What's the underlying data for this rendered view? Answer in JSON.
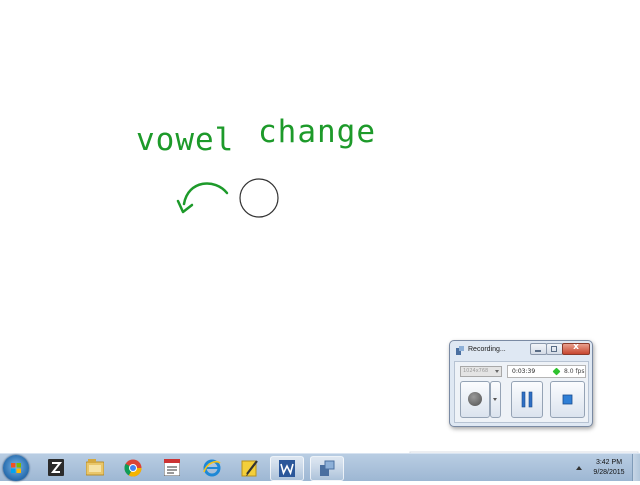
{
  "whiteboard": {
    "text_word1": "vowel",
    "text_word2": "change",
    "ink_color": "#1d9a2a"
  },
  "recorder": {
    "title": "Recording...",
    "close_glyph": "x",
    "resolution_placeholder": "1024x768",
    "elapsed_time": "0:03:39",
    "fps": "8.0 fps",
    "status_color": "#2ec22e"
  },
  "taskbar": {
    "start_icon": "windows-orb-icon",
    "pinned": [
      {
        "name": "filezilla-icon",
        "active": false
      },
      {
        "name": "file-explorer-icon",
        "active": false
      },
      {
        "name": "chrome-icon",
        "active": false
      },
      {
        "name": "calendar-app-icon",
        "active": false
      },
      {
        "name": "internet-explorer-icon",
        "active": false
      },
      {
        "name": "sticky-notes-pen-icon",
        "active": false
      },
      {
        "name": "word-icon",
        "active": true
      },
      {
        "name": "screen-recorder-icon",
        "active": true
      }
    ],
    "clock_time": "3:42 PM",
    "clock_date": "9/28/2015"
  }
}
